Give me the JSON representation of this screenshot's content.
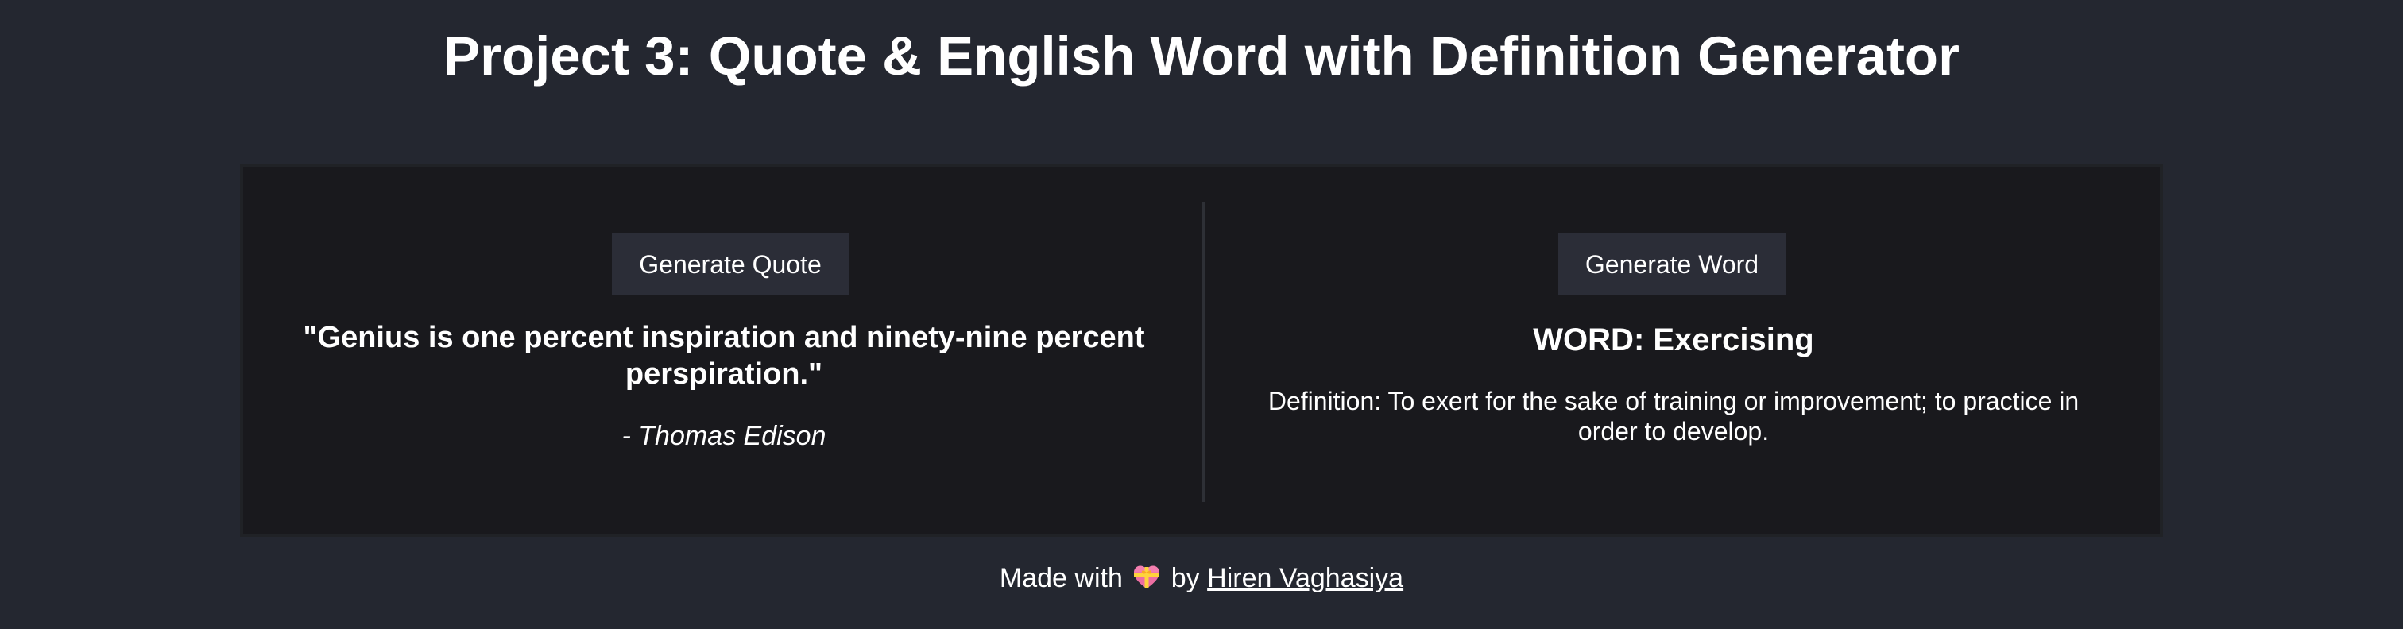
{
  "header": {
    "title": "Project 3: Quote & English Word with Definition Generator"
  },
  "quote_panel": {
    "button_label": "Generate Quote",
    "quote": "\"Genius is one percent inspiration and ninety-nine percent perspiration.\"",
    "author": "- Thomas Edison"
  },
  "word_panel": {
    "button_label": "Generate Word",
    "word_heading": "WORD: Exercising",
    "definition": "Definition: To exert for the sake of training or improvement; to practice in order to develop."
  },
  "footer": {
    "made_with": "Made with",
    "by": "by",
    "author_link": "Hiren Vaghasiya",
    "heart_icon": "heart-with-ribbon-icon"
  },
  "colors": {
    "background": "#242730",
    "card": "#19191d",
    "button": "#2b2d37",
    "text": "#ffffff"
  }
}
